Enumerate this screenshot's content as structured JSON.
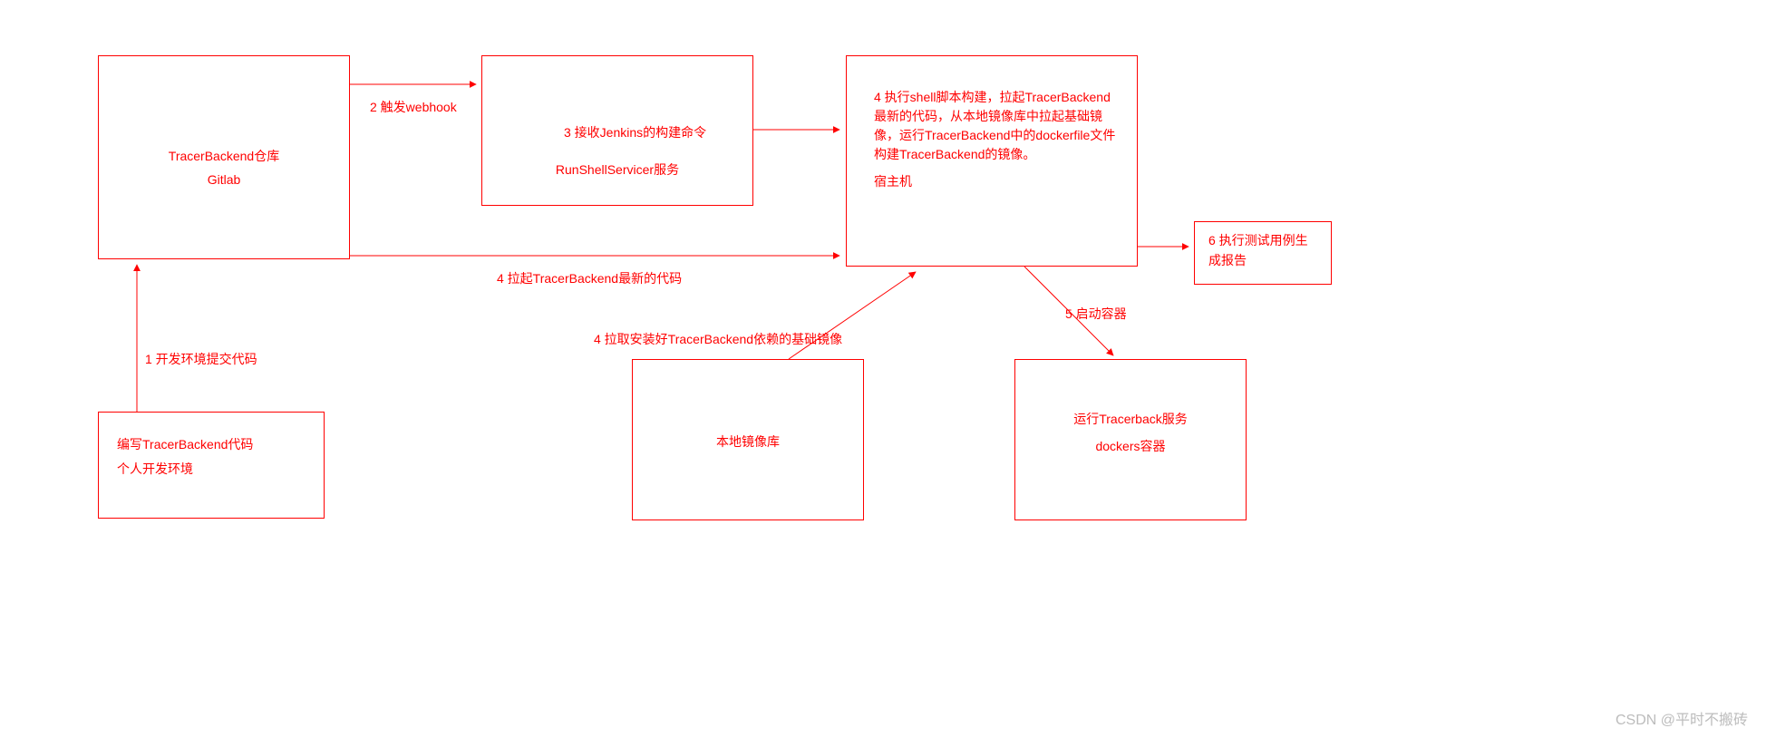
{
  "boxes": {
    "gitlab": {
      "line1": "TracerBackend仓库",
      "line2": "Gitlab"
    },
    "runshell": {
      "line1": "RunShellServicer服务"
    },
    "host": {
      "body": "4 执行shell脚本构建，拉起TracerBackend最新的代码，从本地镜像库中拉起基础镜像，运行TracerBackend中的dockerfile文件构建TracerBackend的镜像。",
      "footer": "宿主机"
    },
    "dev": {
      "line1": "编写TracerBackend代码",
      "line2": "个人开发环境"
    },
    "registry": {
      "line1": "本地镜像库"
    },
    "docker": {
      "line1": "运行Tracerback服务",
      "line2": "dockers容器"
    },
    "report": {
      "line1": "6 执行测试用例生",
      "line2": "成报告"
    }
  },
  "edges": {
    "e1": "1 开发环境提交代码",
    "e2": "2 触发webhook",
    "e3": "3 接收Jenkins的构建命令",
    "e4a": "4 拉起TracerBackend最新的代码",
    "e4b": "4 拉取安装好TracerBackend依赖的基础镜像",
    "e5": "5 启动容器"
  },
  "watermark": "CSDN @平时不搬砖"
}
